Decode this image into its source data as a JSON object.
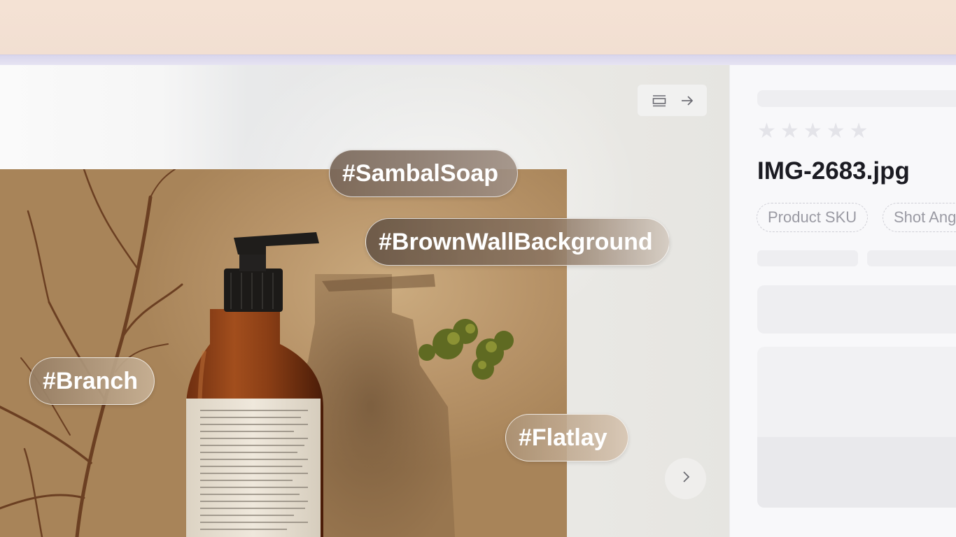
{
  "viewer": {
    "toolbar": {
      "layout_icon": "panel-toggle-icon",
      "arrow_icon": "arrow-right-icon"
    },
    "next_icon": "chevron-right-icon",
    "tags": {
      "sambal": "#SambalSoap",
      "brownwall": "#BrownWallBackground",
      "branch": "#Branch",
      "flatlay": "#Flatlay"
    }
  },
  "details_panel": {
    "rating": {
      "max": 5,
      "value": 0,
      "icon": "star-icon"
    },
    "filename": "IMG-2683.jpg",
    "chips": [
      "Product SKU",
      "Shot Angle"
    ]
  },
  "colors": {
    "top_band": "#f4e2d4",
    "window_edge": "#d9d6ec",
    "panel_bg": "#f8f8fa",
    "skeleton": "#eeeef1",
    "text_dark": "#1b1b22",
    "chip_text": "#9a9aa3"
  }
}
